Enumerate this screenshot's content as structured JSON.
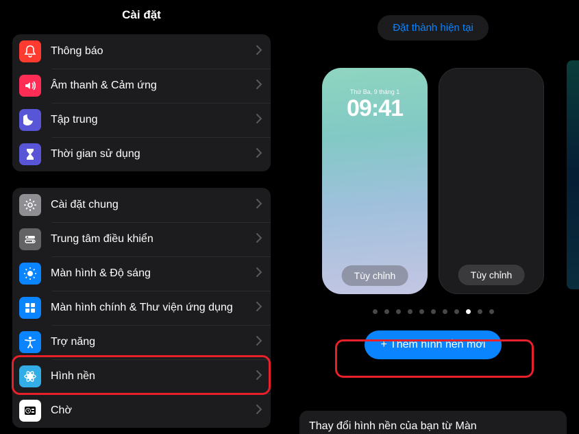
{
  "left": {
    "title": "Cài đặt",
    "group1": [
      {
        "label": "Thông báo",
        "icon": "bell",
        "bg": "bg-red"
      },
      {
        "label": "Âm thanh & Cảm ứng",
        "icon": "speaker",
        "bg": "bg-pink"
      },
      {
        "label": "Tập trung",
        "icon": "moon",
        "bg": "bg-indigo"
      },
      {
        "label": "Thời gian sử dụng",
        "icon": "hourglass",
        "bg": "bg-indigo"
      }
    ],
    "group2": [
      {
        "label": "Cài đặt chung",
        "icon": "gear",
        "bg": "bg-gray"
      },
      {
        "label": "Trung tâm điều khiển",
        "icon": "switches",
        "bg": "bg-graydark"
      },
      {
        "label": "Màn hình & Độ sáng",
        "icon": "sun",
        "bg": "bg-blue"
      },
      {
        "label": "Màn hình chính & Thư viện ứng dụng",
        "icon": "grid",
        "bg": "bg-blue"
      },
      {
        "label": "Trợ năng",
        "icon": "accessibility",
        "bg": "bg-blue"
      },
      {
        "label": "Hình nền",
        "icon": "flower",
        "bg": "bg-lblue",
        "highlighted": true
      },
      {
        "label": "Chờ",
        "icon": "clock",
        "bg": "bg-white"
      }
    ]
  },
  "right": {
    "set_current": "Đặt thành hiện tại",
    "lock_date": "Thứ Ba, 9 tháng 1",
    "lock_time": "09:41",
    "customize": "Tùy chỉnh",
    "customize2": "Tùy chỉnh",
    "add_button": "Thêm hình nền mới",
    "bottom_text": "Thay đổi hình nền của bạn từ Màn",
    "page_dots": {
      "total": 11,
      "active": 8
    }
  }
}
